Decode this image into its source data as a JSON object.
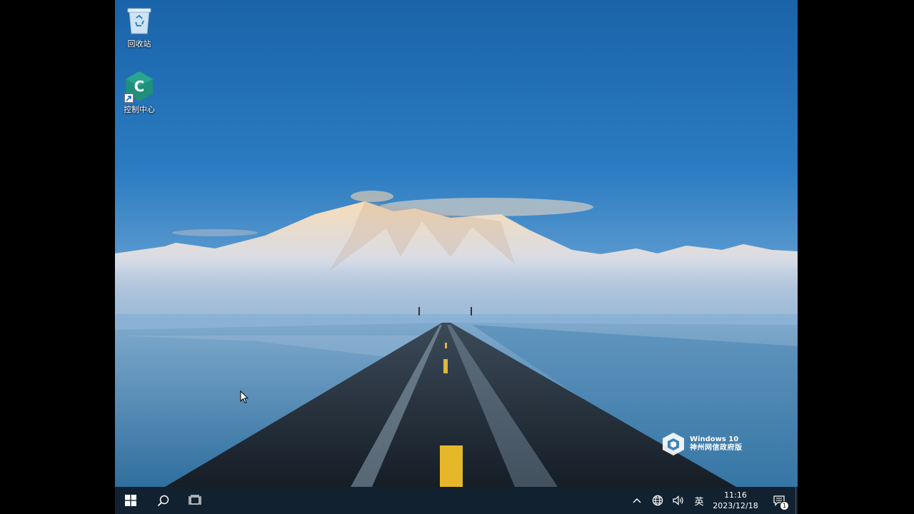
{
  "desktop": {
    "icons": [
      {
        "label": "回收站",
        "icon": "recycle-bin-icon"
      },
      {
        "label": "控制中心",
        "icon": "control-center-icon",
        "glyph": "C"
      }
    ],
    "watermark": {
      "line1": "Windows 10",
      "line2": "神州网信政府版"
    }
  },
  "taskbar": {
    "start_icon": "windows-start-icon",
    "search_icon": "search-icon",
    "task_view_icon": "task-view-icon",
    "tray": {
      "chevron_icon": "chevron-up-icon",
      "network_icon": "globe-network-icon",
      "volume_icon": "volume-icon",
      "ime_label": "英"
    },
    "clock": {
      "time": "11:16",
      "date": "2023/12/18"
    },
    "notifications": {
      "icon": "notification-icon",
      "count": "1"
    }
  },
  "colors": {
    "sky_top": "#1d6fb5",
    "sky_horizon": "#6fa6d6",
    "taskbar": "#121c26",
    "control_center": "#1f8f7c"
  }
}
